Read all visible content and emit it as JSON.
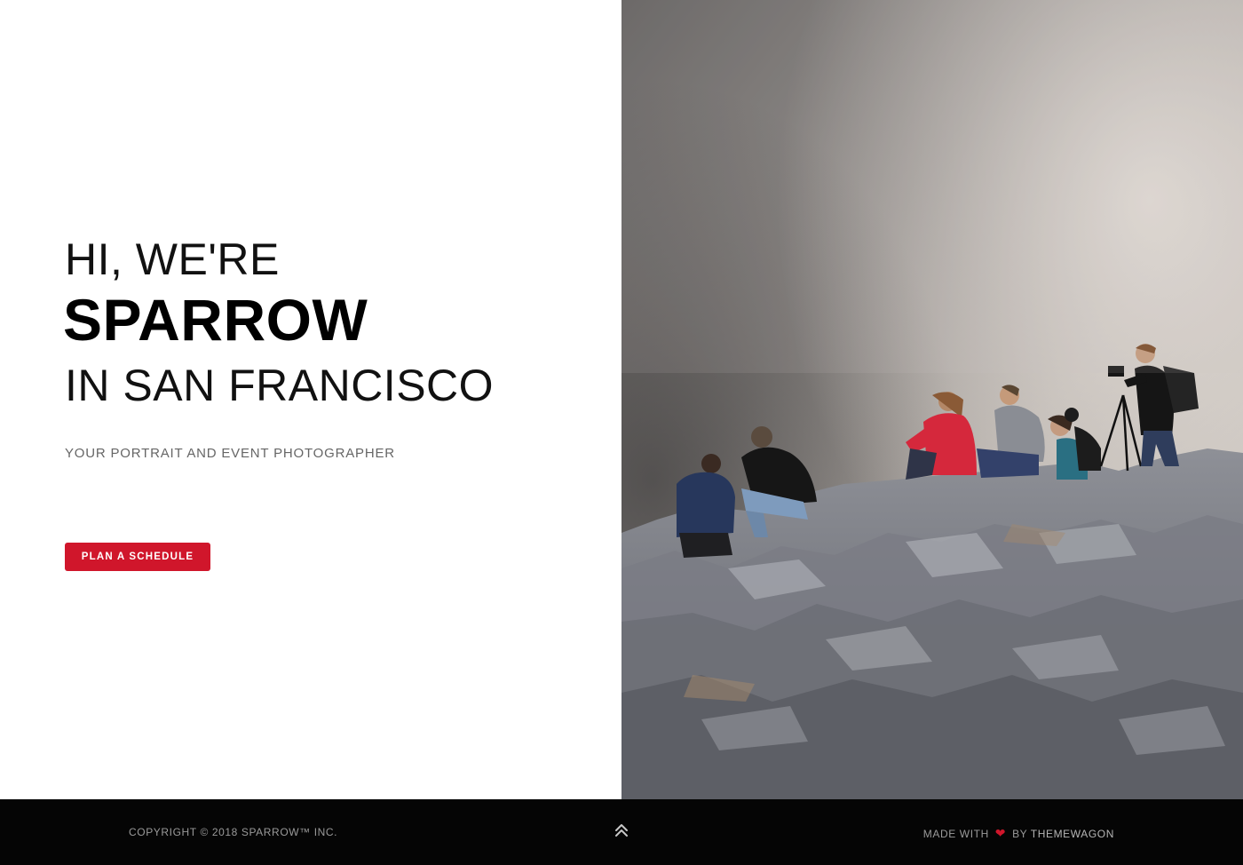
{
  "hero": {
    "greeting": "HI, WE'RE",
    "brand": "SPARROW",
    "location": "IN SAN FRANCISCO",
    "tagline": "YOUR PORTRAIT AND EVENT PHOTOGRAPHER",
    "cta_label": "PLAN A SCHEDULE",
    "photo_subject": "photographers sitting on rocky cliff in mist"
  },
  "footer": {
    "copyright": "COPYRIGHT © 2018 SPARROW™ INC.",
    "back_to_top_icon": "double-chevron-up-icon",
    "made_with_prefix": "MADE WITH",
    "heart_icon": "❤",
    "made_with_suffix": "BY",
    "credit": "THEMEWAGON"
  },
  "colors": {
    "accent": "#d0162b",
    "footer_bg": "#050505",
    "footer_text": "#9a9a9a",
    "heading_text": "#111111",
    "tagline_text": "#666666"
  }
}
